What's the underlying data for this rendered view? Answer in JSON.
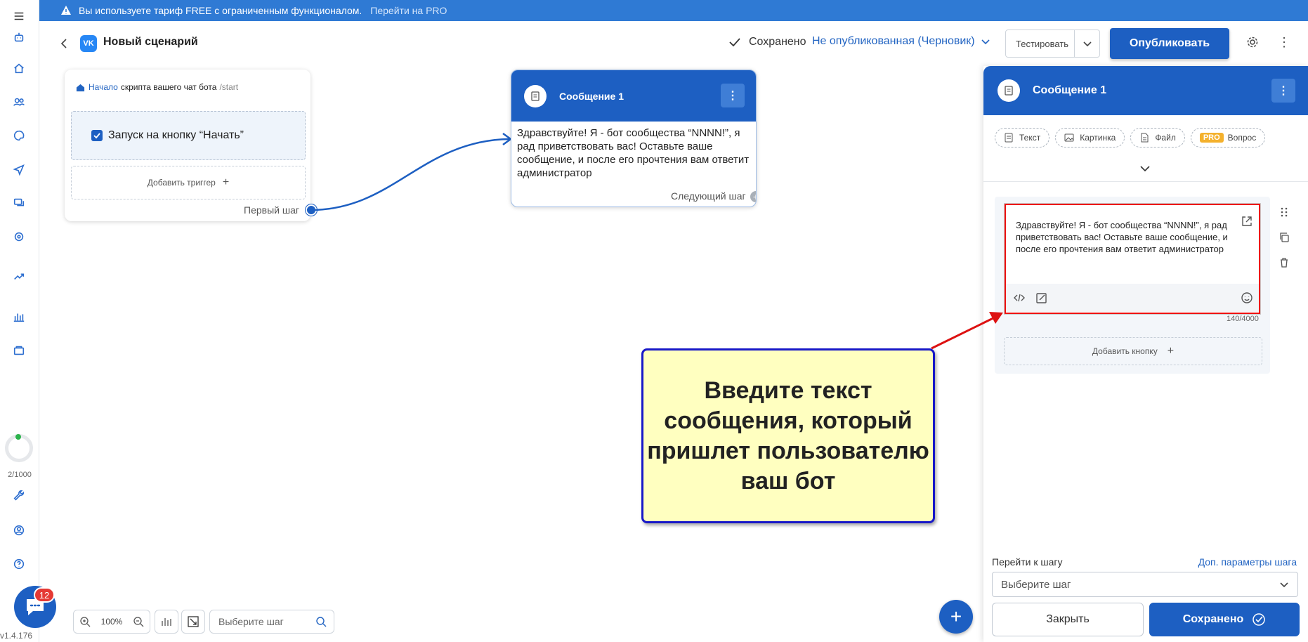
{
  "banner": {
    "message": "Вы используете тариф FREE с ограниченным функционалом.",
    "link": "Перейти на PRO"
  },
  "header": {
    "title": "Новый сценарий",
    "saved": "Сохранено",
    "status": "Не опубликованная (Черновик)",
    "test_label": "Тестировать",
    "publish_label": "Опубликовать"
  },
  "sidebar": {
    "counter": "2/1000",
    "chat_badge": "12",
    "version": "v1.4.176"
  },
  "start_card": {
    "title_link": "Начало",
    "title_text": "скрипта вашего чат бота",
    "title_path": "/start",
    "trigger": "Запуск на кнопку “Начать”",
    "add_trigger": "Добавить триггер",
    "first_step": "Первый шаг"
  },
  "message_card": {
    "title": "Сообщение 1",
    "text": "Здравствуйте! Я - бот сообщества “NNNN!”, я рад приветствовать вас! Оставьте ваше сообщение, и после его прочтения вам ответит администратор",
    "next_step": "Следующий шаг"
  },
  "panel": {
    "title": "Сообщение 1",
    "chips": [
      "Текст",
      "Картинка",
      "Файл",
      "Вопрос"
    ],
    "pro_badge": "PRO",
    "editor_text": "Здравствуйте! Я - бот сообщества “NNNN!”, я рад приветствовать вас! Оставьте ваше сообщение, и после его прочтения вам ответит администратор",
    "char_count": "140/4000",
    "add_button": "Добавить кнопку",
    "goto_label": "Перейти к шагу",
    "extra_params": "Доп. параметры шага",
    "step_placeholder": "Выберите шаг",
    "close_label": "Закрыть",
    "saved_label": "Сохранено"
  },
  "callout": {
    "text": "Введите текст сообщения, который пришлет пользователю ваш бот"
  },
  "toolbar": {
    "zoom": "100%",
    "search_placeholder": "Выберите шаг"
  },
  "colors": {
    "primary": "#1d5fc2",
    "banner": "#2f7ad4",
    "callout_bg": "#ffffc0",
    "callout_border": "#1818c8",
    "highlight": "#e11111"
  }
}
